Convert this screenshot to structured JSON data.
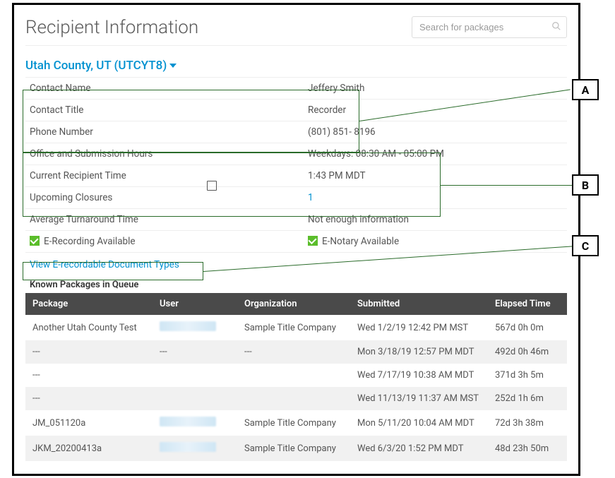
{
  "header": {
    "title": "Recipient Information",
    "search_placeholder": "Search for packages"
  },
  "county": {
    "label": "Utah County, UT (UTCYT8)"
  },
  "info": {
    "contact_name_label": "Contact Name",
    "contact_name_value": "Jeffery Smith",
    "contact_title_label": "Contact Title",
    "contact_title_value": "Recorder",
    "phone_label": "Phone Number",
    "phone_value": "(801) 851- 8196",
    "hours_label": "Office and Submission Hours",
    "hours_value": "Weekdays: 08:30 AM - 05:00 PM",
    "current_time_label": "Current Recipient Time",
    "current_time_value": "1:43 PM MDT",
    "closures_label": "Upcoming Closures",
    "closures_value": "1",
    "turnaround_label": "Average Turnaround Time",
    "turnaround_value": "Not enough information"
  },
  "availability": {
    "e_recording": "E-Recording Available",
    "e_notary": "E-Notary Available"
  },
  "view_types_label": "View E-recordable Document Types",
  "queue_heading": "Known Packages in Queue",
  "table": {
    "headers": {
      "package": "Package",
      "user": "User",
      "organization": "Organization",
      "submitted": "Submitted",
      "elapsed": "Elapsed Time"
    },
    "rows": [
      {
        "package": "Another Utah County Test",
        "package_link": true,
        "user_blurred": true,
        "org": "Sample Title Company",
        "org_link": true,
        "submitted": "Wed 1/2/19 12:42 PM MST",
        "elapsed": "567d 0h 0m"
      },
      {
        "package": "---",
        "package_link": false,
        "user": "---",
        "org": "---",
        "org_link": false,
        "submitted": "Mon 3/18/19 12:57 PM MDT",
        "elapsed": "492d 0h 46m"
      },
      {
        "package": "---",
        "package_link": false,
        "user": "",
        "org": "",
        "org_link": false,
        "submitted": "Wed 7/17/19 10:38 AM MDT",
        "elapsed": "371d 3h 5m"
      },
      {
        "package": "---",
        "package_link": false,
        "user": "",
        "org": "",
        "org_link": false,
        "submitted": "Wed 11/13/19 11:37 AM MST",
        "elapsed": "252d 1h 6m"
      },
      {
        "package": "JM_051120a",
        "package_link": true,
        "user_blurred": true,
        "org": "Sample Title Company",
        "org_link": true,
        "submitted": "Mon 5/11/20 10:04 AM MDT",
        "elapsed": "72d 3h 38m"
      },
      {
        "package": "JKM_20200413a",
        "package_link": true,
        "user_blurred": true,
        "org": "Sample Title Company",
        "org_link": true,
        "submitted": "Wed 6/3/20 1:52 PM MDT",
        "elapsed": "48d 23h 50m"
      }
    ]
  },
  "annotations": {
    "A": "A",
    "B": "B",
    "C": "C"
  }
}
